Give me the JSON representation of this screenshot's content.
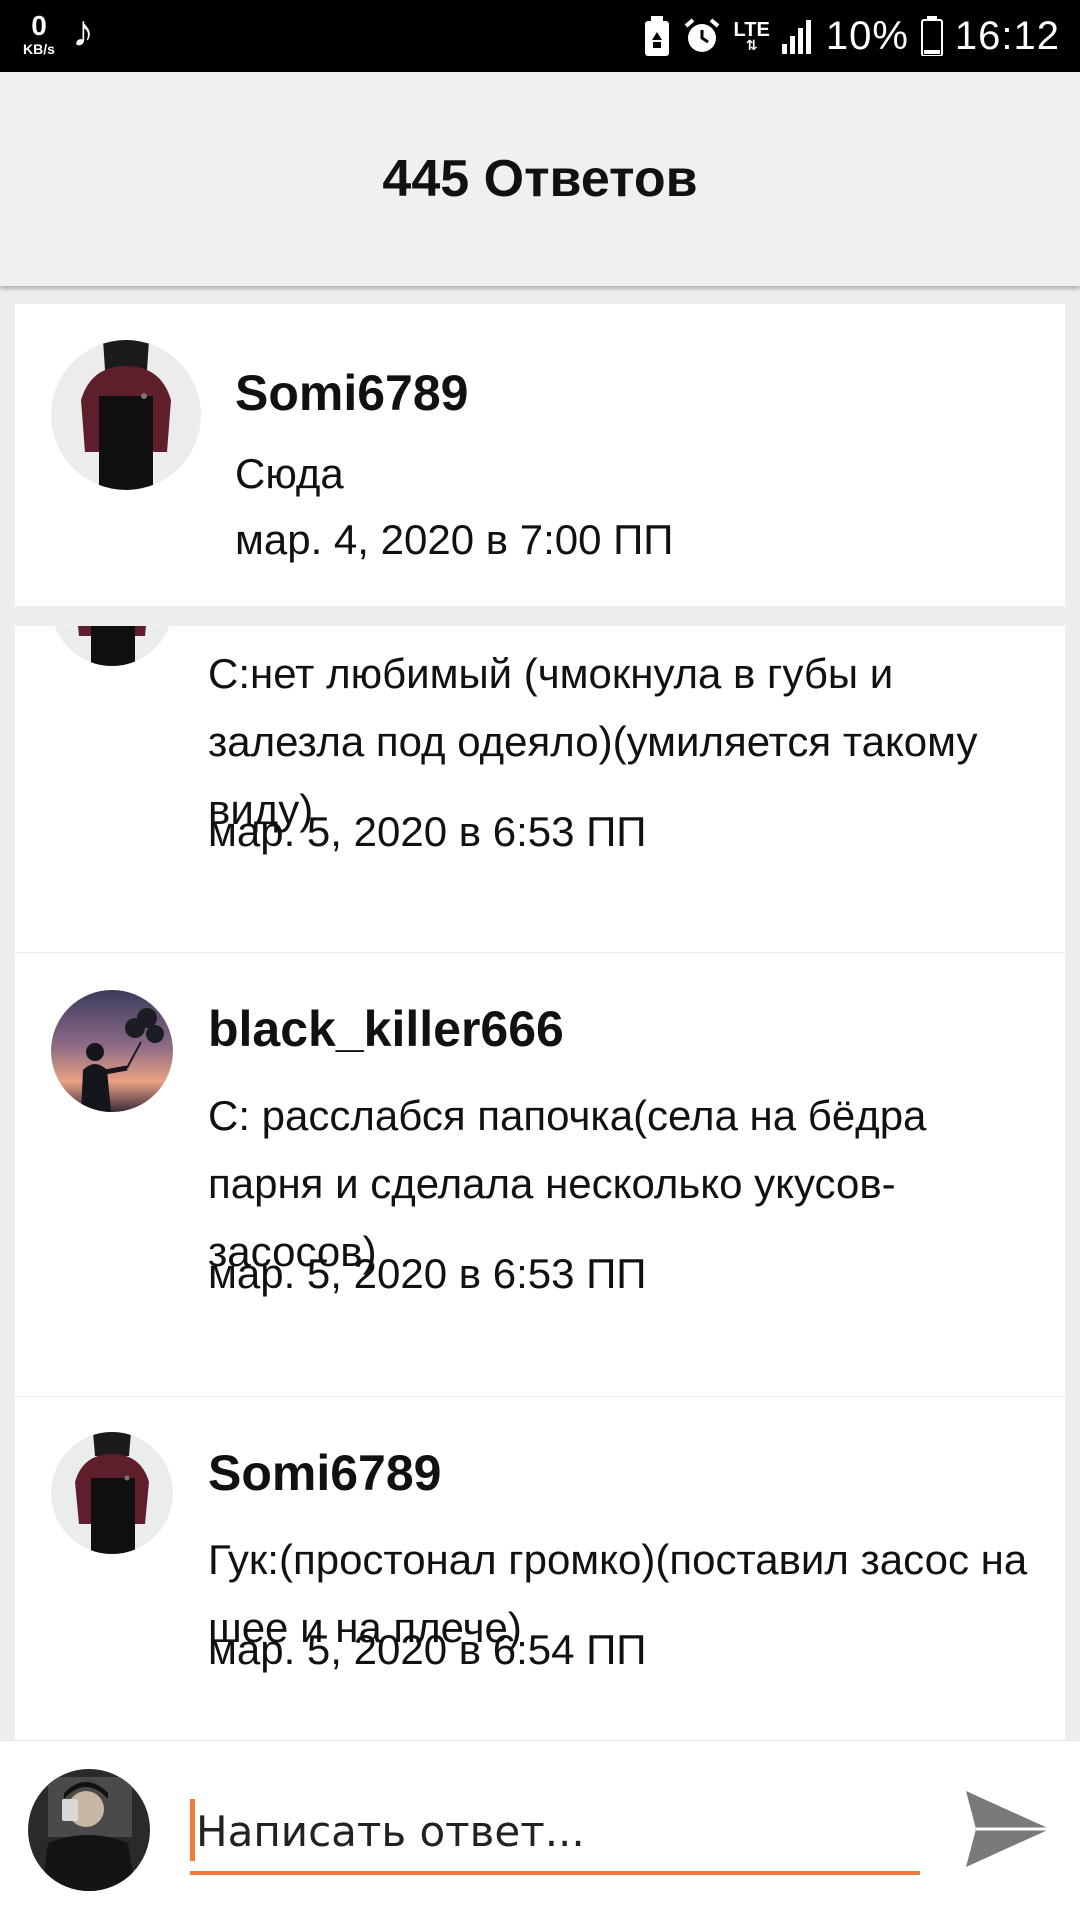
{
  "status_bar": {
    "net_speed_value": "0",
    "net_speed_unit": "KB/s",
    "network": "LTE",
    "battery_percent": "10%",
    "time": "16:12"
  },
  "header": {
    "title": "445 Ответов"
  },
  "top_post": {
    "username": "Somi6789",
    "text": "Сюда",
    "timestamp": "мар. 4, 2020 в 7:00 ПП"
  },
  "replies": [
    {
      "username": "",
      "text": "С:нет любимый (чмокнула в губы и залезла под одеяло)(умиляется такому виду)",
      "timestamp": "мар. 5, 2020 в 6:53 ПП"
    },
    {
      "username": "black_killer666",
      "text": "С: расслабся папочка(села на бёдра парня и сделала несколько укусов-засосов)",
      "timestamp": "мар. 5, 2020 в 6:53 ПП"
    },
    {
      "username": "Somi6789",
      "text": "Гук:(простонал громко)(поставил засос на шее и на плече)",
      "timestamp": "мар. 5, 2020 в 6:54 ПП"
    }
  ],
  "reply_bar": {
    "placeholder": "Написать ответ..."
  },
  "colors": {
    "accent": "#f37a3a",
    "header_bg": "#f1f0f1",
    "status_bar_bg": "#000000"
  },
  "icons": {
    "music": "music-note-icon",
    "recycle_battery": "battery-saver-icon",
    "alarm": "alarm-icon",
    "signal": "signal-bars-icon",
    "battery": "battery-icon",
    "send": "send-icon"
  }
}
